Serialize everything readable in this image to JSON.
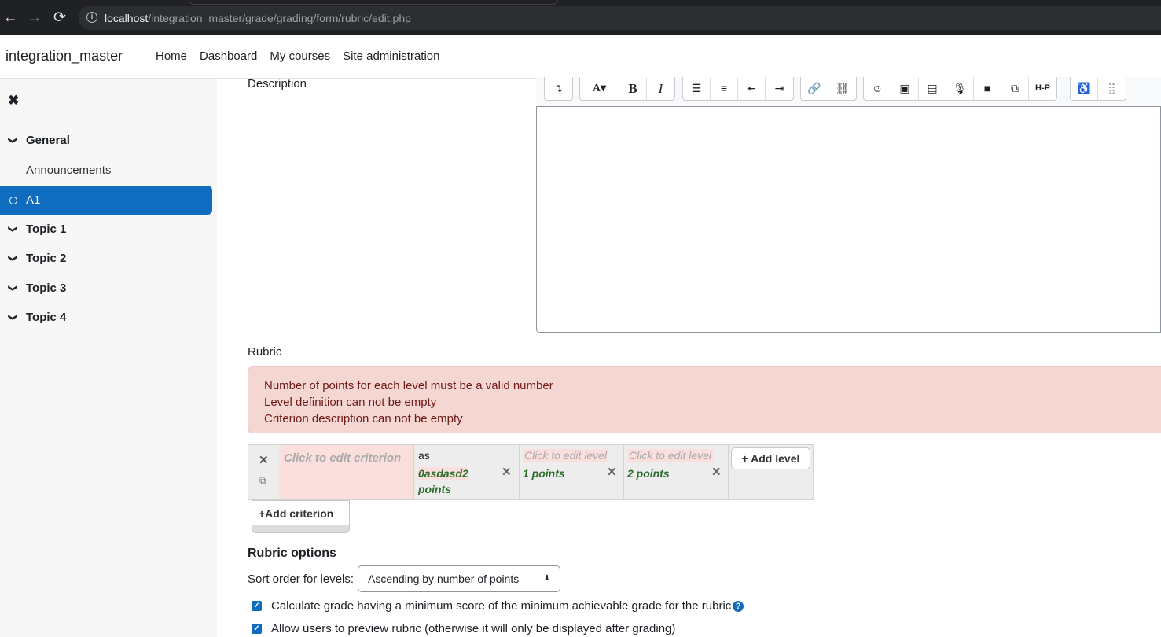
{
  "browser": {
    "url_host": "localhost",
    "url_path": "/integration_master/grade/grading/form/rubric/edit.php",
    "back_icon": "←",
    "forward_icon": "→",
    "reload_icon": "⟳",
    "info_icon": "i"
  },
  "navbar": {
    "brand": "integration_master",
    "links": [
      "Home",
      "Dashboard",
      "My courses",
      "Site administration"
    ]
  },
  "sidebar": {
    "close_icon": "✖",
    "items": [
      {
        "label": "General",
        "type": "section",
        "chevron": "❯"
      },
      {
        "label": "Announcements",
        "type": "sub"
      },
      {
        "label": "A1",
        "type": "active"
      },
      {
        "label": "Topic 1",
        "type": "section",
        "chevron": "❯"
      },
      {
        "label": "Topic 2",
        "type": "section",
        "chevron": "❯"
      },
      {
        "label": "Topic 3",
        "type": "section",
        "chevron": "❯"
      },
      {
        "label": "Topic 4",
        "type": "section",
        "chevron": "❯"
      }
    ]
  },
  "form": {
    "description_label": "Description",
    "toolbar": {
      "g1": [
        "↴"
      ],
      "g2": [
        "A▾",
        "B",
        "I"
      ],
      "g3": [
        "☰",
        "≡",
        "⇤",
        "⇥"
      ],
      "g4": [
        "🔗",
        "⛓"
      ],
      "g5": [
        "☺",
        "▣",
        "▤",
        "🎙",
        "■",
        "⧉",
        "H-P"
      ],
      "g6": [
        "♿",
        "⣿"
      ]
    },
    "rubric_label": "Rubric",
    "errors": [
      "Number of points for each level must be a valid number",
      "Level definition can not be empty",
      "Criterion description can not be empty"
    ],
    "rubric": {
      "delete_icon": "✕",
      "duplicate_icon": "⧉",
      "criterion_placeholder": "Click to edit criterion",
      "levels": [
        {
          "definition": "as",
          "points": "0asdasd2",
          "points_suffix": "points"
        },
        {
          "definition": "Click to edit level",
          "points": "1 points"
        },
        {
          "definition": "Click to edit level",
          "points": "2 points"
        }
      ],
      "add_level": "+ Add level",
      "add_criterion": "+Add criterion"
    },
    "options_title": "Rubric options",
    "sort_label": "Sort order for levels:",
    "sort_value": "Ascending by number of points",
    "sort_arrow": "⬍",
    "check_mark": "✓",
    "checkboxes": [
      {
        "label": "Calculate grade having a minimum score of the minimum achievable grade for the rubric",
        "checked": true,
        "help": "?"
      },
      {
        "label": "Allow users to preview rubric (otherwise it will only be displayed after grading)",
        "checked": true
      }
    ],
    "colors": {
      "primary": "#0f6cbf",
      "error_bg": "#f4d6d2",
      "error_text": "#6e1a16",
      "points_green": "#2c6e2a"
    }
  }
}
